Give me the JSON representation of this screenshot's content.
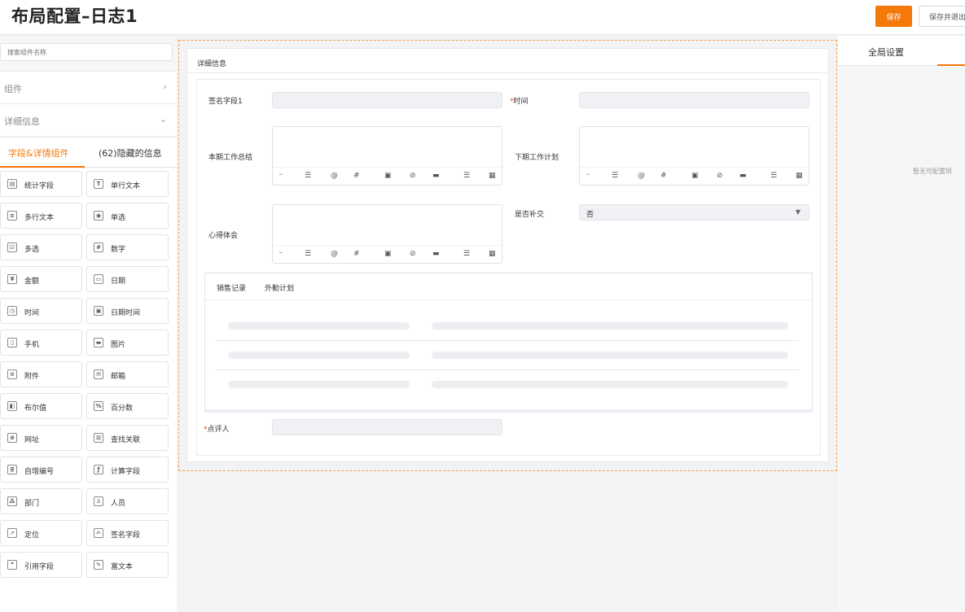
{
  "header": {
    "title": "布局配置–日志1",
    "save_label": "保存",
    "save_exit_label": "保存并退出"
  },
  "sidebar": {
    "search_placeholder": "搜索组件名称",
    "section_components": "组件",
    "section_details": "详细信息",
    "tab_fields": "字段&详情组件",
    "tab_hidden": "(62)隐藏的信息",
    "components": [
      {
        "label": "统计字段",
        "icon": "statistics-icon",
        "glyph": "▤"
      },
      {
        "label": "单行文本",
        "icon": "text-icon",
        "glyph": "T"
      },
      {
        "label": "多行文本",
        "icon": "multiline-text-icon",
        "glyph": "≡"
      },
      {
        "label": "单选",
        "icon": "radio-icon",
        "glyph": "◉"
      },
      {
        "label": "多选",
        "icon": "checkbox-icon",
        "glyph": "☑"
      },
      {
        "label": "数字",
        "icon": "number-icon",
        "glyph": "#"
      },
      {
        "label": "金额",
        "icon": "currency-icon",
        "glyph": "¥"
      },
      {
        "label": "日期",
        "icon": "date-icon",
        "glyph": "▭"
      },
      {
        "label": "时间",
        "icon": "clock-icon",
        "glyph": "◷"
      },
      {
        "label": "日期时间",
        "icon": "datetime-icon",
        "glyph": "▣"
      },
      {
        "label": "手机",
        "icon": "phone-icon",
        "glyph": "▯"
      },
      {
        "label": "图片",
        "icon": "image-icon",
        "glyph": "▬"
      },
      {
        "label": "附件",
        "icon": "attachment-icon",
        "glyph": "⊘"
      },
      {
        "label": "邮箱",
        "icon": "email-icon",
        "glyph": "✉"
      },
      {
        "label": "布尔值",
        "icon": "boolean-icon",
        "glyph": "◧"
      },
      {
        "label": "百分数",
        "icon": "percent-icon",
        "glyph": "%"
      },
      {
        "label": "网址",
        "icon": "globe-icon",
        "glyph": "⊕"
      },
      {
        "label": "查找关联",
        "icon": "lookup-icon",
        "glyph": "⊡"
      },
      {
        "label": "自增编号",
        "icon": "autonumber-icon",
        "glyph": "≣"
      },
      {
        "label": "计算字段",
        "icon": "formula-icon",
        "glyph": "ƒ"
      },
      {
        "label": "部门",
        "icon": "department-icon",
        "glyph": "⁂"
      },
      {
        "label": "人员",
        "icon": "user-icon",
        "glyph": "♙"
      },
      {
        "label": "定位",
        "icon": "location-icon",
        "glyph": "➚"
      },
      {
        "label": "签名字段",
        "icon": "signature-icon",
        "glyph": "✍"
      },
      {
        "label": "引用字段",
        "icon": "quote-icon",
        "glyph": "❞"
      },
      {
        "label": "富文本",
        "icon": "richtext-icon",
        "glyph": "✎"
      }
    ]
  },
  "canvas": {
    "card_title": "详细信息",
    "fields": {
      "signature": "签名字段1",
      "time": "时间",
      "work_summary": "本期工作总结",
      "next_plan": "下期工作计划",
      "experience": "心得体会",
      "makeup": "是否补交",
      "makeup_value": "否",
      "reviewer": "点评人"
    },
    "required_mark": "*",
    "toolbar_glyphs": [
      "ᵕ",
      "☰",
      "@",
      "#",
      "▣",
      "⊘",
      "▬",
      "☰",
      "▦"
    ],
    "subtabs": [
      "销售记录",
      "外勤计划"
    ]
  },
  "right": {
    "title": "全局设置",
    "empty_text": "暂无可配置项"
  }
}
